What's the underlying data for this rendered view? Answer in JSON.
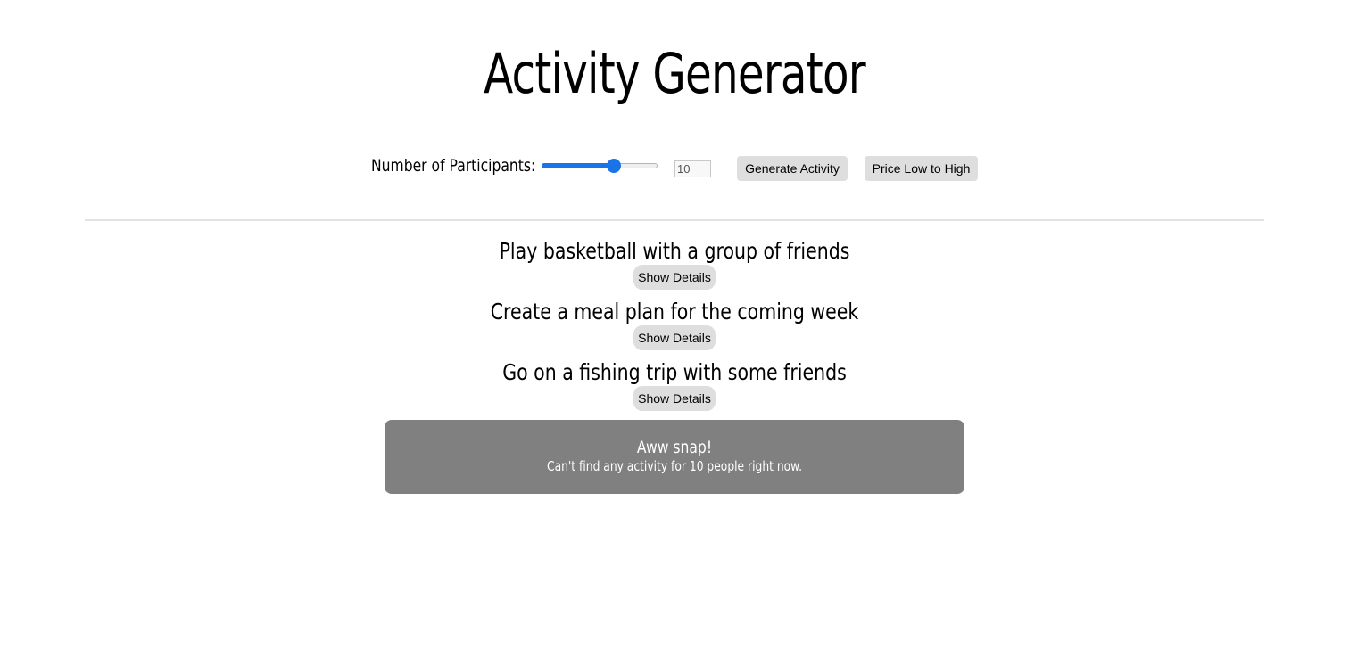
{
  "page_title": "Activity Generator",
  "controls": {
    "participants_label": "Number of Participants:",
    "slider_value": 10,
    "slider_min": 1,
    "slider_max": 15,
    "input_value": "10",
    "generate_label": "Generate Activity",
    "price_sort_label": "Price Low to High"
  },
  "activities": [
    {
      "title": "Play basketball with a group of friends",
      "details_label": "Show Details"
    },
    {
      "title": "Create a meal plan for the coming week",
      "details_label": "Show Details"
    },
    {
      "title": "Go on a fishing trip with some friends",
      "details_label": "Show Details"
    }
  ],
  "alert": {
    "title": "Aww snap!",
    "message": "Can't find any activity for 10 people right now."
  },
  "colors": {
    "accent": "#1a73e8",
    "alert_background": "#808080",
    "button_background": "#dedede"
  }
}
